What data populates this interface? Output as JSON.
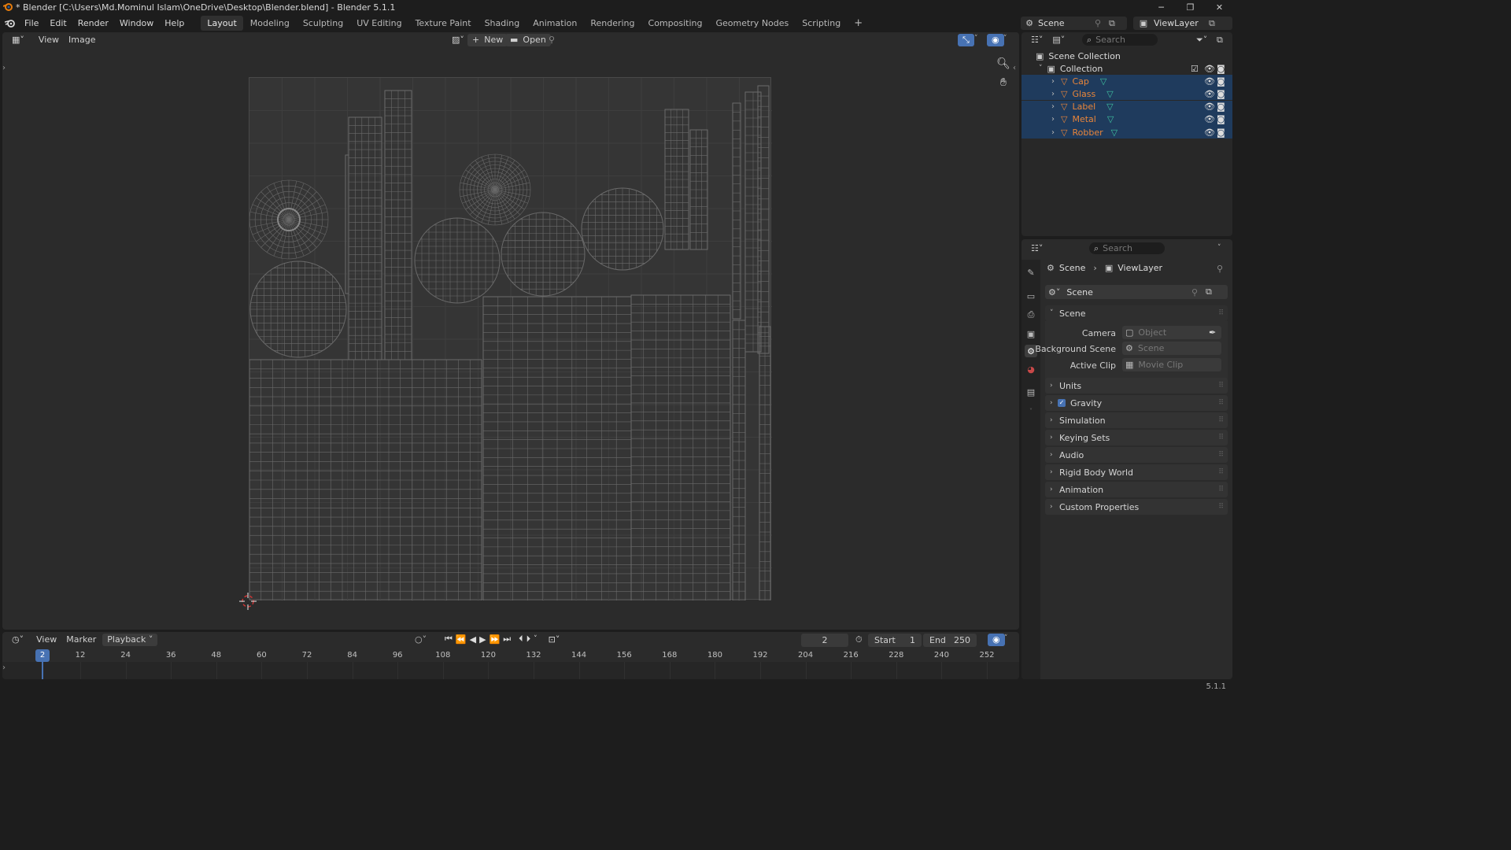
{
  "window": {
    "title": "* Blender [C:\\Users\\Md.Mominul Islam\\OneDrive\\Desktop\\Blender.blend] - Blender 5.1.1"
  },
  "menu": [
    "File",
    "Edit",
    "Render",
    "Window",
    "Help"
  ],
  "workspaces": [
    "Layout",
    "Modeling",
    "Sculpting",
    "UV Editing",
    "Texture Paint",
    "Shading",
    "Animation",
    "Rendering",
    "Compositing",
    "Geometry Nodes",
    "Scripting"
  ],
  "active_workspace": "Layout",
  "top_right": {
    "scene": "Scene",
    "view_layer": "ViewLayer"
  },
  "image_editor": {
    "view_menu": "View",
    "image_menu": "Image",
    "new_label": "New",
    "open_label": "Open"
  },
  "timeline": {
    "view": "View",
    "marker": "Marker",
    "playback": "Playback",
    "current_frame": "2",
    "start_label": "Start",
    "start": "1",
    "end_label": "End",
    "end": "250",
    "playhead": "2",
    "ticks": [
      "12",
      "24",
      "36",
      "48",
      "60",
      "72",
      "84",
      "96",
      "108",
      "120",
      "132",
      "144",
      "156",
      "168",
      "180",
      "192",
      "204",
      "216",
      "228",
      "240",
      "252"
    ]
  },
  "outliner": {
    "search_placeholder": "Search",
    "scene_collection": "Scene Collection",
    "collection": "Collection",
    "objects": [
      "Cap",
      "Glass",
      "Label",
      "Metal",
      "Robber"
    ]
  },
  "properties": {
    "search_placeholder": "Search",
    "breadcrumb_scene": "Scene",
    "breadcrumb_viewlayer": "ViewLayer",
    "scene_datablock": "Scene",
    "scene_panel": "Scene",
    "camera_label": "Camera",
    "camera_placeholder": "Object",
    "bg_scene_label": "Background Scene",
    "bg_scene_placeholder": "Scene",
    "active_clip_label": "Active Clip",
    "active_clip_placeholder": "Movie Clip",
    "panels": [
      "Units",
      "Gravity",
      "Simulation",
      "Keying Sets",
      "Audio",
      "Rigid Body World",
      "Animation",
      "Custom Properties"
    ]
  },
  "status": {
    "version": "5.1.1"
  },
  "colors": {
    "accent": "#4772b3",
    "selection": "#1f3b5d",
    "object": "#e8853a",
    "mesh_icon": "#3fc1a0"
  }
}
